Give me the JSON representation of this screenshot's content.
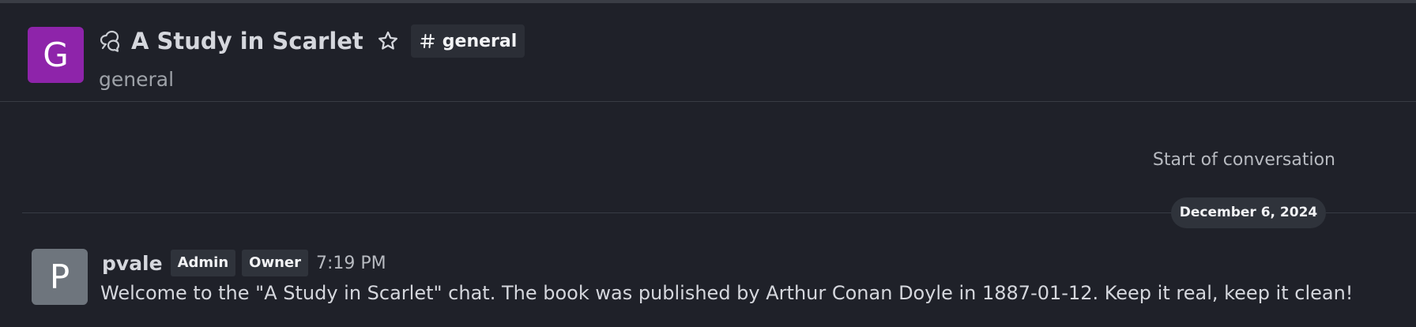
{
  "header": {
    "avatar_letter": "G",
    "avatar_color": "#8e24aa",
    "title": "A Study in Scarlet",
    "channel_chip": "general",
    "topic": "general"
  },
  "conversation": {
    "start_label": "Start of conversation",
    "date_divider": "December 6, 2024"
  },
  "messages": [
    {
      "avatar_letter": "P",
      "avatar_color": "#6e757d",
      "username": "pvale",
      "roles": [
        "Admin",
        "Owner"
      ],
      "time": "7:19 PM",
      "text": "Welcome to the \"A Study in Scarlet\" chat. The book was published by Arthur Conan Doyle in 1887-01-12. Keep it real, keep it clean!"
    }
  ],
  "icons": {
    "discussion": "discussion-icon",
    "favorite": "star-icon",
    "channel": "hash-icon"
  },
  "colors": {
    "background": "#1f2129",
    "badge_background": "#2f333b",
    "divider": "#383b44"
  }
}
